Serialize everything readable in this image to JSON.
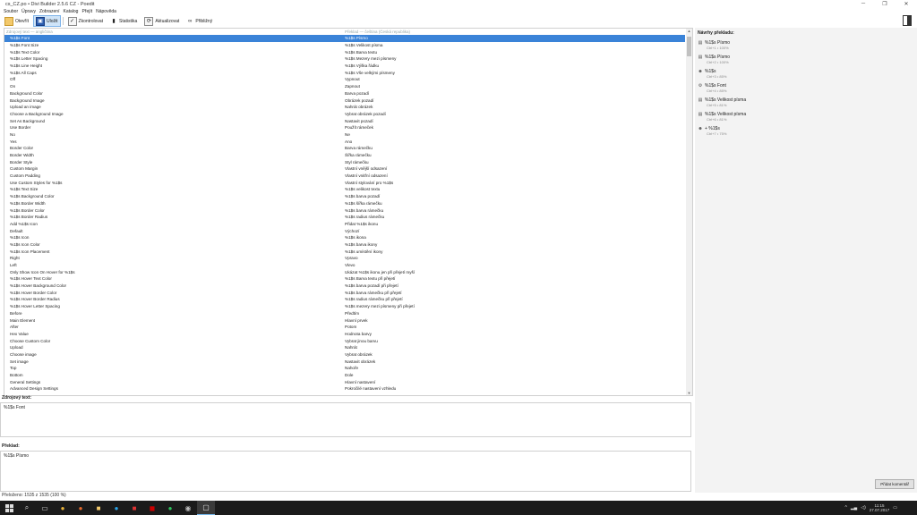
{
  "window": {
    "title": "cs_CZ.po • Divi Builder 2.5.6 CZ - Poedit",
    "controls": [
      "─",
      "❐",
      "✕"
    ]
  },
  "menu": [
    "Soubor",
    "Úpravy",
    "Zobrazení",
    "Katalog",
    "Přejít",
    "Nápověda"
  ],
  "toolbar": {
    "open": "Otevřít",
    "save": "Uložit",
    "validate": "Zkontrolovat",
    "stats": "Statistika",
    "update": "Aktualizovat",
    "preview": "Přibližný"
  },
  "list": {
    "header_source": "Zdrojový text — angličtina",
    "header_translation": "Překlad — čeština (Česká republika)",
    "rows": [
      [
        "%1$s Font",
        "%1$s Písmo"
      ],
      [
        "%1$s Font Size",
        "%1$s Velikost písma"
      ],
      [
        "%1$s Text Color",
        "%1$s Barva textu"
      ],
      [
        "%1$s Letter Spacing",
        "%1$s Mezery mezi písmeny"
      ],
      [
        "%1$s Line Height",
        "%1$s Výška řádku"
      ],
      [
        "%1$s All Caps",
        "%1$s Vše velkými písmeny"
      ],
      [
        "Off",
        "Vypnout"
      ],
      [
        "On",
        "Zapnout"
      ],
      [
        "Background Color",
        "Barva pozadí"
      ],
      [
        "Background Image",
        "Obrázek pozadí"
      ],
      [
        "Upload an image",
        "Nahrát obrázek"
      ],
      [
        "Choose a Background Image",
        "Vybrat obrázek pozadí"
      ],
      [
        "Set As Background",
        "Nastavit pozadí"
      ],
      [
        "Use Border",
        "Použít rámeček"
      ],
      [
        "No",
        "Ne"
      ],
      [
        "Yes",
        "Ano"
      ],
      [
        "Border Color",
        "Barva rámečku"
      ],
      [
        "Border Width",
        "Šířka rámečku"
      ],
      [
        "Border Style",
        "Styl rámečku"
      ],
      [
        "Custom Margin",
        "Vlastní vnější odsazení"
      ],
      [
        "Custom Padding",
        "Vlastní vnitřní odsazení"
      ],
      [
        "Use Custom Styles for %1$s",
        "Vlastní stylování pro %1$s"
      ],
      [
        "%1$s Text Size",
        "%1$s velikost textu"
      ],
      [
        "%1$s Background Color",
        "%1$s barva pozadí"
      ],
      [
        "%1$s Border Width",
        "%1$s šířka rámečku"
      ],
      [
        "%1$s Border Color",
        "%1$s barva rámečku"
      ],
      [
        "%1$s Border Radius",
        "%1$s radius rámečku"
      ],
      [
        "Add %1$s Icon",
        "Přidat %1$s ikonu"
      ],
      [
        "Default",
        "Výchozí"
      ],
      [
        "%1$s Icon",
        "%1$s ikona"
      ],
      [
        "%1$s Icon Color",
        "%1$s barva ikony"
      ],
      [
        "%1$s Icon Placement",
        "%1$s umístění ikony"
      ],
      [
        "Right",
        "Vpravo"
      ],
      [
        "Left",
        "Vlevo"
      ],
      [
        "Only Show Icon On Hover for %1$s",
        "Ukázat %1$s ikonu jen při přejetí myší"
      ],
      [
        "%1$s Hover Text Color",
        "%1$s Barva textu při přejetí"
      ],
      [
        "%1$s Hover Background Color",
        "%1$s barva pozadí při přejetí"
      ],
      [
        "%1$s Hover Border Color",
        "%1$s barva rámečku při přejetí"
      ],
      [
        "%1$s Hover Border Radius",
        "%1$s radius rámečku při přejetí"
      ],
      [
        "%1$s Hover Letter Spacing",
        "%1$s mezery mezi písmeny při přejetí"
      ],
      [
        "Before",
        "Předtím"
      ],
      [
        "Main Element",
        "Hlavní prvek"
      ],
      [
        "After",
        "Potom"
      ],
      [
        "Hex Value",
        "Hodnota barvy"
      ],
      [
        "Choose Custom Color",
        "Vybrat jinou barvu"
      ],
      [
        "Upload",
        "Nahrát"
      ],
      [
        "Choose image",
        "Vybrat obrázek"
      ],
      [
        "Set image",
        "Nastavit obrázek"
      ],
      [
        "Top",
        "Nahoře"
      ],
      [
        "Bottom",
        "Dole"
      ],
      [
        "General Settings",
        "Hlavní nastavení"
      ],
      [
        "Advanced Design Settings",
        "Pokročilé nastavení vzhledu"
      ]
    ]
  },
  "source_panel": {
    "label": "Zdrojový text:",
    "value": "%1$s Font"
  },
  "translation_panel": {
    "label": "Překlad:",
    "value": "%1$s Písmo"
  },
  "suggestions": {
    "title": "Návrhy překladu:",
    "items": [
      {
        "text": "%1$s Písmo",
        "sub": "Ctrl+1 • 100%"
      },
      {
        "text": "%1$s Písmo",
        "sub": "Ctrl+2 • 100%"
      },
      {
        "text": "%1$s",
        "sub": "Ctrl+3 • 85%"
      },
      {
        "text": "%1$s Font",
        "sub": "Ctrl+4 • 85%"
      },
      {
        "text": "%1$s Velikost písma",
        "sub": "Ctrl+5 • 81%"
      },
      {
        "text": "%1$s Velikost písma",
        "sub": "Ctrl+6 • 81%"
      },
      {
        "text": "+ %1$s",
        "sub": "Ctrl+7 • 75%"
      }
    ],
    "add_comment": "Přidat komentář"
  },
  "status": "Přeloženo: 1535 z 1535 (100 %)",
  "taskbar": {
    "time": "11:15",
    "date": "27.07.2017"
  }
}
